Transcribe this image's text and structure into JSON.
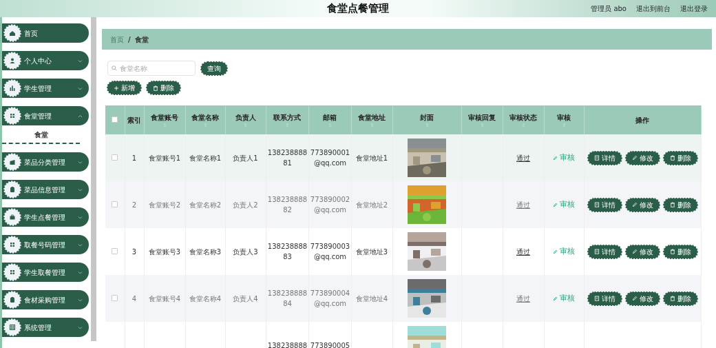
{
  "header": {
    "title": "食堂点餐管理",
    "links": [
      "管理员 abo",
      "退出到前台",
      "退出登录"
    ]
  },
  "sidebar": {
    "items": [
      {
        "label": "首页",
        "kind": "link"
      },
      {
        "label": "个人中心",
        "kind": "menu",
        "expanded": false
      },
      {
        "label": "学生管理",
        "kind": "menu",
        "expanded": false
      },
      {
        "label": "食堂管理",
        "kind": "menu",
        "expanded": true,
        "children": [
          {
            "label": "食堂",
            "selected": true
          }
        ]
      },
      {
        "label": "菜品分类管理",
        "kind": "menu",
        "expanded": false
      },
      {
        "label": "菜品信息管理",
        "kind": "menu",
        "expanded": false
      },
      {
        "label": "学生点餐管理",
        "kind": "menu",
        "expanded": false
      },
      {
        "label": "取餐号码管理",
        "kind": "menu",
        "expanded": false
      },
      {
        "label": "学生取餐管理",
        "kind": "menu",
        "expanded": false
      },
      {
        "label": "食材采购管理",
        "kind": "menu",
        "expanded": false
      },
      {
        "label": "系统管理",
        "kind": "menu",
        "expanded": false
      }
    ]
  },
  "breadcrumb": {
    "items": [
      "首页",
      "食堂"
    ],
    "separator": "/"
  },
  "search": {
    "placeholder": "食堂名称",
    "button": "查询"
  },
  "toolbar": [
    {
      "label": "新增",
      "kind": "add"
    },
    {
      "label": "删除",
      "kind": "delete"
    }
  ],
  "table": {
    "all_checked": false,
    "columns": [
      {
        "kind": "checkbox"
      },
      {
        "label": "索引",
        "sortable": false
      },
      {
        "label": "食堂账号",
        "sortable": true
      },
      {
        "label": "食堂名称",
        "sortable": true
      },
      {
        "label": "负责人",
        "sortable": true
      },
      {
        "label": "联系方式",
        "sortable": true
      },
      {
        "label": "邮箱",
        "sortable": true
      },
      {
        "label": "食堂地址",
        "sortable": true
      },
      {
        "label": "封面",
        "sortable": true
      },
      {
        "label": "审核回复",
        "sortable": true
      },
      {
        "label": "审核状态",
        "sortable": true
      },
      {
        "label": "审核",
        "sortable": true
      },
      {
        "label": "操作",
        "sortable": false
      }
    ],
    "rows": [
      {
        "checked": false,
        "index": "1",
        "account": "食堂账号1",
        "name": "食堂名称1",
        "person": "负责人1",
        "phone": "13823888881",
        "email": "773890001@qq.com",
        "address": "食堂地址1",
        "status": "通过",
        "audit": "审核",
        "actions": [
          "详情",
          "修改",
          "删除"
        ],
        "highlighted": true
      },
      {
        "checked": false,
        "index": "2",
        "account": "食堂账号2",
        "name": "食堂名称2",
        "person": "负责人2",
        "phone": "13823888882",
        "email": "773890002@qq.com",
        "address": "食堂地址2",
        "status": "通过",
        "audit": "审核",
        "actions": [
          "详情",
          "修改",
          "删除"
        ],
        "highlighted": false
      },
      {
        "checked": false,
        "index": "3",
        "account": "食堂账号3",
        "name": "食堂名称3",
        "person": "负责人3",
        "phone": "13823888883",
        "email": "773890003@qq.com",
        "address": "食堂地址3",
        "status": "通过",
        "audit": "审核",
        "actions": [
          "详情",
          "修改",
          "删除"
        ],
        "highlighted": false
      },
      {
        "checked": false,
        "index": "4",
        "account": "食堂账号4",
        "name": "食堂名称4",
        "person": "负责人4",
        "phone": "13823888884",
        "email": "773890004@qq.com",
        "address": "食堂地址4",
        "status": "通过",
        "audit": "审核",
        "actions": [
          "详情",
          "修改",
          "删除"
        ],
        "highlighted": false
      },
      {
        "phone": "138238888",
        "email": "773890005",
        "highlighted": false
      }
    ]
  }
}
